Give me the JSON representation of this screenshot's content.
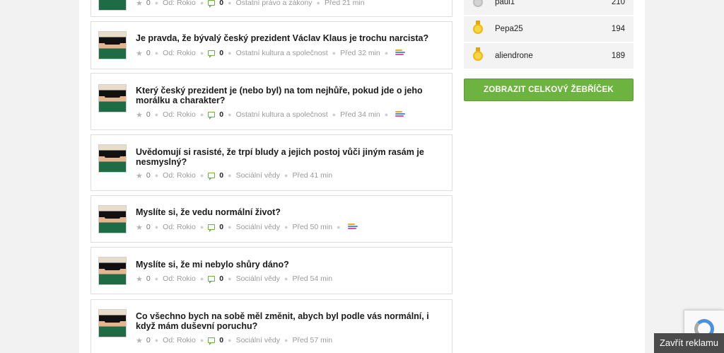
{
  "questions": [
    {
      "title": "",
      "stars": "0",
      "author": "Od: Rokio",
      "answers": "0",
      "category": "Ostatní právo a zákony",
      "time": "Před 21 min",
      "level": false
    },
    {
      "title": "Je pravda, že bývalý český prezident Václav Klaus je trochu narcista?",
      "stars": "0",
      "author": "Od: Rokio",
      "answers": "0",
      "category": "Ostatní kultura a společnost",
      "time": "Před 32 min",
      "level": true
    },
    {
      "title": "Který český prezident je (nebo byl) na tom nejhůře, pokud jde o jeho morálku a charakter?",
      "stars": "0",
      "author": "Od: Rokio",
      "answers": "0",
      "category": "Ostatní kultura a společnost",
      "time": "Před 34 min",
      "level": true
    },
    {
      "title": "Uvědomují si rasisté, že trpí bludy a jejich postoj vůči jiným rasám je nesmyslný?",
      "stars": "0",
      "author": "Od: Rokio",
      "answers": "0",
      "category": "Sociální vědy",
      "time": "Před 41 min",
      "level": false
    },
    {
      "title": "Myslíte si, že vedu normální život?",
      "stars": "0",
      "author": "Od: Rokio",
      "answers": "0",
      "category": "Sociální vědy",
      "time": "Před 50 min",
      "level": true
    },
    {
      "title": "Myslíte si, že mi nebylo shůry dáno?",
      "stars": "0",
      "author": "Od: Rokio",
      "answers": "0",
      "category": "Sociální vědy",
      "time": "Před 54 min",
      "level": false
    },
    {
      "title": "Co všechno bych na sobě měl změnit, abych byl podle vás normální, i když mám duševní poruchu?",
      "stars": "0",
      "author": "Od: Rokio",
      "answers": "0",
      "category": "Sociální vědy",
      "time": "Před 57 min",
      "level": false
    }
  ],
  "leaderboard": [
    {
      "name": "paul1",
      "score": "210",
      "medal": "silver"
    },
    {
      "name": "Pepa25",
      "score": "194",
      "medal": "gold"
    },
    {
      "name": "aliendrone",
      "score": "189",
      "medal": "gold"
    }
  ],
  "leaderboard_button": "ZOBRAZIT CELKOVÝ ŽEBŘÍČEK",
  "ad_close": "Zavřít reklamu",
  "colors": {
    "accent_green": "#6cb33f",
    "medal_gold": "#f5c518",
    "medal_silver": "#c4c4c4"
  }
}
